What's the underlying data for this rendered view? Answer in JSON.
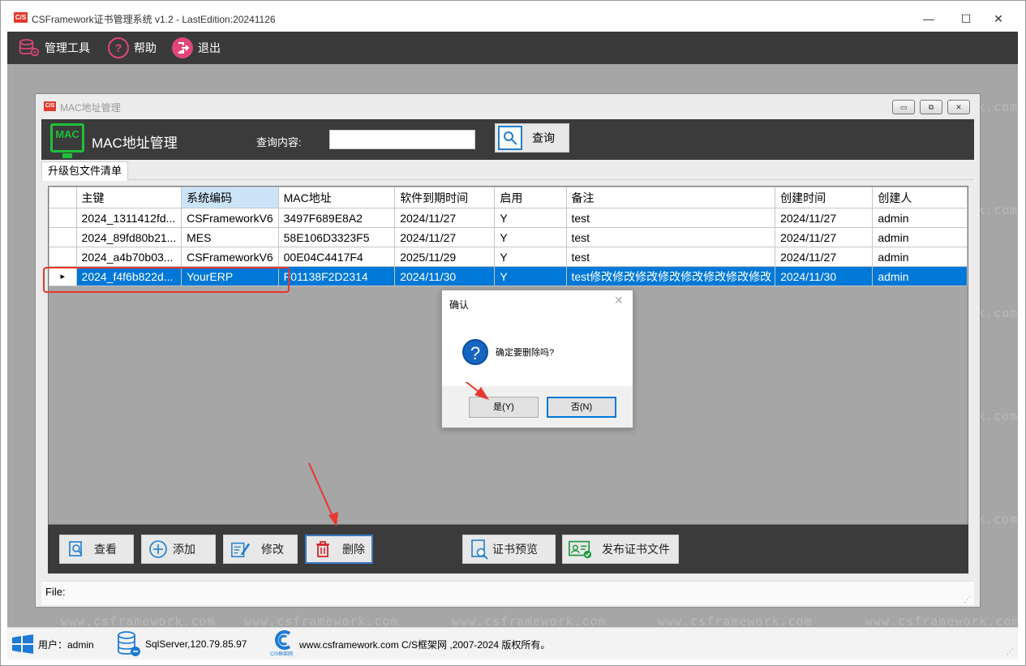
{
  "window": {
    "title": "CSFramework证书管理系统 v1.2 - LastEdition:20241126",
    "logo_text": "C/S",
    "minimize": "—",
    "maximize": "☐",
    "close": "✕"
  },
  "menu": [
    {
      "label": "管理工具",
      "icon": "database-gear-icon"
    },
    {
      "label": "帮助",
      "icon": "help-icon"
    },
    {
      "label": "退出",
      "icon": "exit-icon"
    }
  ],
  "watermark": "www.csframework.com",
  "watermark_edge": "k.com",
  "child_window": {
    "title": "MAC地址管理",
    "logo_text": "C/S",
    "header_icon_text": "MAC",
    "header_title": "MAC地址管理",
    "query_label": "查询内容:",
    "query_value": "",
    "query_button": "查询",
    "tab": "升级包文件清单",
    "file_label": "File:"
  },
  "grid": {
    "columns": [
      "主键",
      "系统编码",
      "MAC地址",
      "软件到期时间",
      "启用",
      "备注",
      "创建时间",
      "创建人"
    ],
    "rows": [
      [
        "2024_1311412fd...",
        "CSFrameworkV6",
        "3497F689E8A2",
        "2024/11/27",
        "Y",
        "test",
        "2024/11/27",
        "admin"
      ],
      [
        "2024_89fd80b21...",
        "MES",
        "58E106D3323F5",
        "2024/11/27",
        "Y",
        "test",
        "2024/11/27",
        "admin"
      ],
      [
        "2024_a4b70b03...",
        "CSFrameworkV6",
        "00E04C4417F4",
        "2025/11/29",
        "Y",
        "test",
        "2024/11/27",
        "admin"
      ],
      [
        "2024_f4f6b822d...",
        "YourERP",
        "F01138F2D2314",
        "2024/11/30",
        "Y",
        "test修改修改修改修改修改修改修改修改",
        "2024/11/30",
        "admin"
      ]
    ],
    "selected_row": 3,
    "current_row_marker": "▸"
  },
  "buttons": {
    "view": "查看",
    "add": "添加",
    "edit": "修改",
    "delete": "删除",
    "preview": "证书预览",
    "publish": "发布证书文件"
  },
  "dialog": {
    "title": "确认",
    "close": "✕",
    "icon": "?",
    "message": "确定要删除吗?",
    "yes": "是(Y)",
    "no": "否(N)"
  },
  "statusbar": {
    "user": "用户：admin",
    "server": "SqlServer,120.79.85.97",
    "copyright": "www.csframework.com C/S框架网 ,2007-2024 版权所有。",
    "logo_caption": "C/S框架网"
  },
  "colors": {
    "accent": "#0078d7",
    "annotation": "#e8382f",
    "dark_bar": "#3b3b3b",
    "mdi_bg": "#a6a6a6"
  }
}
